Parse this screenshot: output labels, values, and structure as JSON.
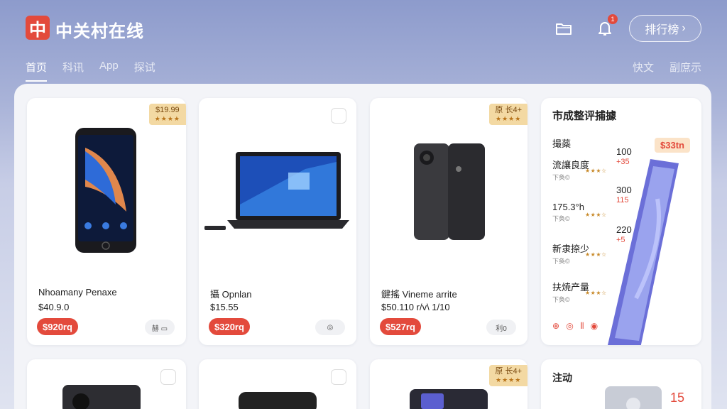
{
  "header": {
    "logo_char": "中",
    "brand": "中关村在线",
    "notification_count": "1",
    "rank_button": "排行榜",
    "tabs": [
      "首页",
      "科讯",
      "App",
      "探试"
    ],
    "right_tabs": [
      "快文",
      "副庶示"
    ]
  },
  "products": [
    {
      "name": "Nhoamany Penaxe",
      "price": "$40.9.0",
      "pill": "$920rq",
      "tag": "$19.99",
      "tag_stars": "★★★★",
      "action": "赫 ▭"
    },
    {
      "name": "攝 Opnlan",
      "price": "$15.55",
      "pill": "$320rq",
      "action": "◎"
    },
    {
      "name": "鍵搖 Vineme arrite",
      "price": "$50.110 r/v\\ 1/10",
      "pill": "$527rq",
      "tag": "原 长4+",
      "tag_stars": "★★★★",
      "action": "利0"
    }
  ],
  "ranking": {
    "title": "市成整评捕據",
    "sub": "撮蘂",
    "price_tag": "$33tn",
    "rows": [
      {
        "name": "流讓良度",
        "sub": "下奂©",
        "value": "100",
        "change": "+35"
      },
      {
        "name": "175.3°h",
        "sub": "下奂©",
        "value": "300",
        "change": "115"
      },
      {
        "name": "新隶捺少",
        "sub": "下奂©",
        "value": "220",
        "change": "+5"
      },
      {
        "name": "扶焼产量",
        "sub": "下奂©",
        "value": "",
        "change": ""
      }
    ],
    "icons": "⊕ ◎ ⦀ ◉"
  },
  "bottom": {
    "tag": "原 长4+",
    "tag_stars": "★★★★",
    "card4_title": "注动",
    "card4_num": "15"
  },
  "colors": {
    "accent": "#e34a3c",
    "tag_bg": "#f3d9a3"
  }
}
